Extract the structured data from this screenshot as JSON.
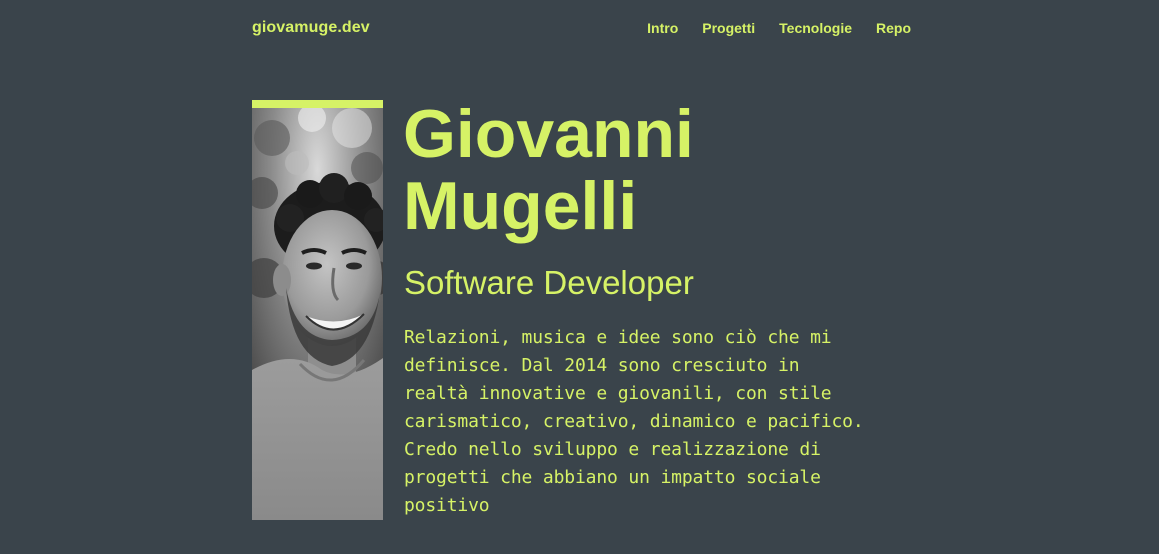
{
  "header": {
    "logo": "giovamuge.dev",
    "nav": [
      "Intro",
      "Progetti",
      "Tecnologie",
      "Repo"
    ]
  },
  "hero": {
    "name_line1": "Giovanni",
    "name_line2": "Mugelli",
    "role": "Software Developer",
    "bio": "Relazioni, musica e idee sono ciò che mi\ndefinisce. Dal 2014 sono cresciuto in\nrealtà innovative e giovanili, con stile\ncarismatico, creativo, dinamico e pacifico.\nCredo nello sviluppo e realizzazione di\nprogetti che abbiano un impatto sociale\npositivo"
  },
  "colors": {
    "background": "#3a444b",
    "accent": "#d6f266"
  }
}
